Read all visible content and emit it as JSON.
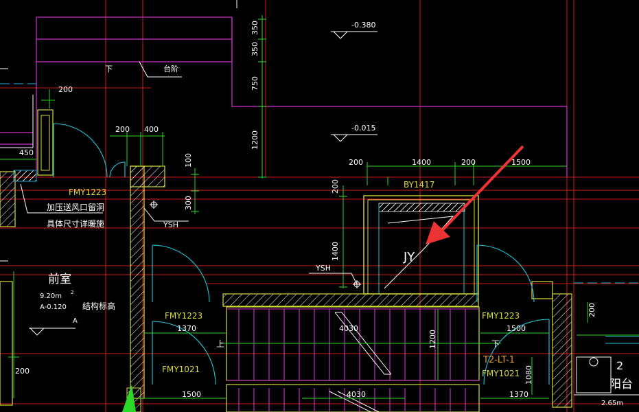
{
  "drawing": {
    "levels": {
      "upper": "-0.380",
      "middle": "-0.015"
    },
    "dims_vertical_top": [
      "350",
      "350",
      "750",
      "1200"
    ],
    "dims_misc": {
      "d200_left": "200",
      "d200_door": "200",
      "d400": "400",
      "d450": "450",
      "d100": "100",
      "d300": "300",
      "d200_shaft": "200",
      "d1400_shaft": "1400",
      "d1400_top": "1400",
      "d200_top_a": "200",
      "d200_top_b": "200",
      "d1500_top": "1500",
      "d200_right": "200",
      "d200_bottom_left": "200",
      "d1370_left": "1370",
      "d4030_top": "4030",
      "d1200_stair": "1200",
      "d1500_right": "1500",
      "d1080_right": "1080",
      "d1500_bottom_left": "1500",
      "d4030_bottom": "4030",
      "d1370_bottom_right": "1370"
    },
    "labels": {
      "down_top": "下",
      "steps": "台阶",
      "window_by": "BY1417",
      "jy": "JY",
      "ysh_left": "YSH",
      "ysh_shaft": "YSH",
      "door_fmy1223_top": "FMY1223",
      "note_line1": "加压送风口留洞",
      "note_line2": "具体尺寸详暖施",
      "room_name": "前室",
      "room_area": "9.20m",
      "room_area_sup": "2",
      "room_level": "A-0.120",
      "structural_note": "结构标高",
      "axis_a": "A",
      "door_fmy1223_left": "FMY1223",
      "door_fmy1223_right": "FMY1223",
      "door_fmy1021_left": "FMY1021",
      "door_fmy1021_right": "FMY1021",
      "stair_up": "上",
      "stair_down": "下",
      "stair_id": "T2-LT-1",
      "balcony_num": "2",
      "balcony_name": "阳台",
      "balcony_area": "2.65m"
    }
  }
}
